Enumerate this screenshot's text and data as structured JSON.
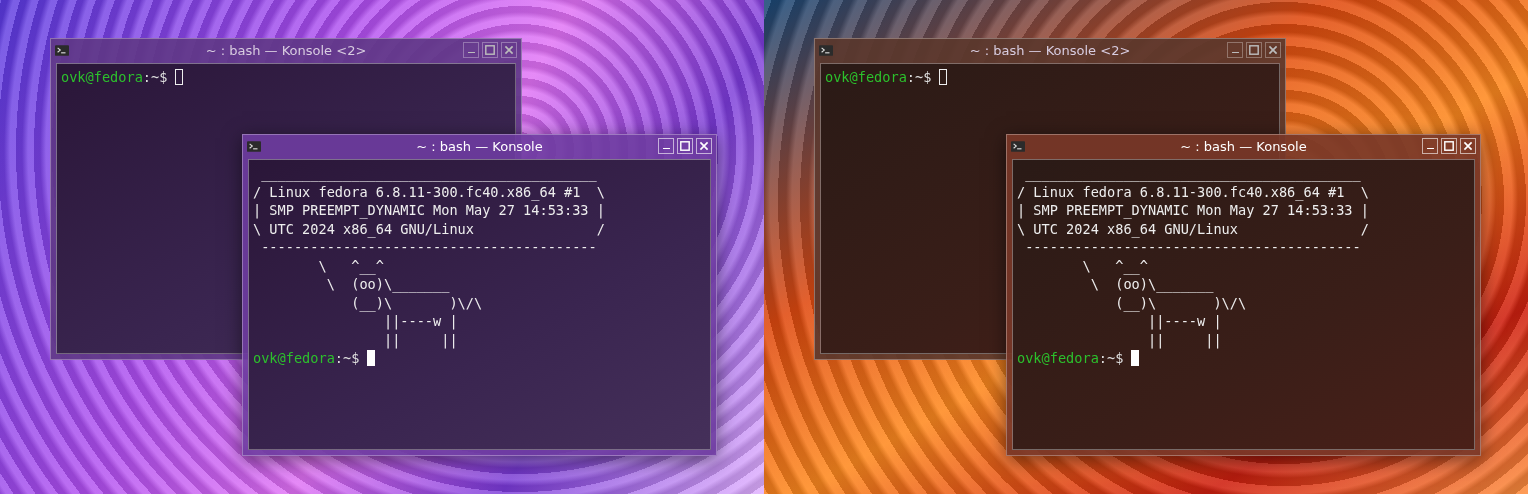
{
  "desktops": [
    {
      "kind": "violet",
      "windows": [
        {
          "title": "~ : bash — Konsole <2>",
          "active": false,
          "prompt": {
            "user": "ovk@fedora",
            "rest": ":~$"
          }
        },
        {
          "title": "~ : bash — Konsole",
          "active": true,
          "lines": [
            " _________________________________________",
            "/ Linux fedora 6.8.11-300.fc40.x86_64 #1  \\",
            "| SMP PREEMPT_DYNAMIC Mon May 27 14:53:33 |",
            "\\ UTC 2024 x86_64 GNU/Linux               /",
            " -----------------------------------------",
            "        \\   ^__^",
            "         \\  (oo)\\_______",
            "            (__)\\       )\\/\\",
            "                ||----w |",
            "                ||     ||"
          ],
          "prompt": {
            "user": "ovk@fedora",
            "rest": ":~$"
          }
        }
      ]
    },
    {
      "kind": "sunset",
      "windows": [
        {
          "title": "~ : bash — Konsole <2>",
          "active": false,
          "prompt": {
            "user": "ovk@fedora",
            "rest": ":~$"
          }
        },
        {
          "title": "~ : bash — Konsole",
          "active": true,
          "lines": [
            " _________________________________________",
            "/ Linux fedora 6.8.11-300.fc40.x86_64 #1  \\",
            "| SMP PREEMPT_DYNAMIC Mon May 27 14:53:33 |",
            "\\ UTC 2024 x86_64 GNU/Linux               /",
            " -----------------------------------------",
            "        \\   ^__^",
            "         \\  (oo)\\_______",
            "            (__)\\       )\\/\\",
            "                ||----w |",
            "                ||     ||"
          ],
          "prompt": {
            "user": "ovk@fedora",
            "rest": ":~$"
          }
        }
      ]
    }
  ]
}
